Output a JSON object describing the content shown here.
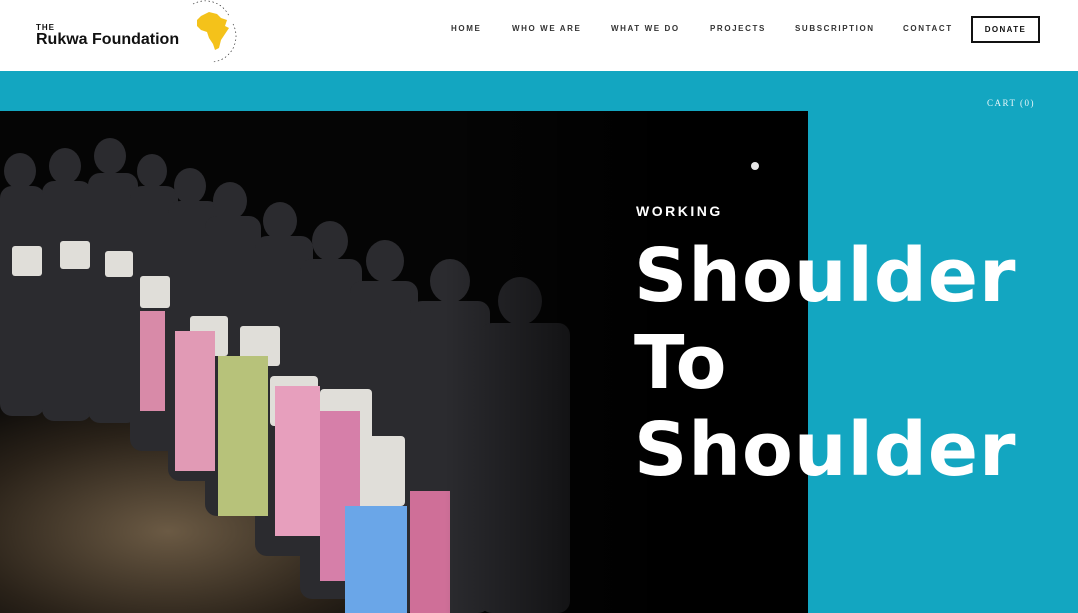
{
  "header": {
    "logo": {
      "small_text": "THE",
      "name": "Rukwa Foundation",
      "badge_text": "baga kwa baga"
    },
    "nav": [
      {
        "label": "HOME"
      },
      {
        "label": "WHO WE ARE"
      },
      {
        "label": "WHAT WE DO"
      },
      {
        "label": "PROJECTS"
      },
      {
        "label": "SUBSCRIPTION"
      },
      {
        "label": "CONTACT"
      }
    ],
    "donate_label": "DONATE"
  },
  "hero": {
    "cart_label": "CART (0)",
    "eyebrow": "WORKING",
    "headline": [
      "Shoulder",
      "To",
      "Shoulder"
    ],
    "colors": {
      "accent": "#13a6c1",
      "photo_bg": "#050505",
      "text": "#ffffff"
    }
  }
}
